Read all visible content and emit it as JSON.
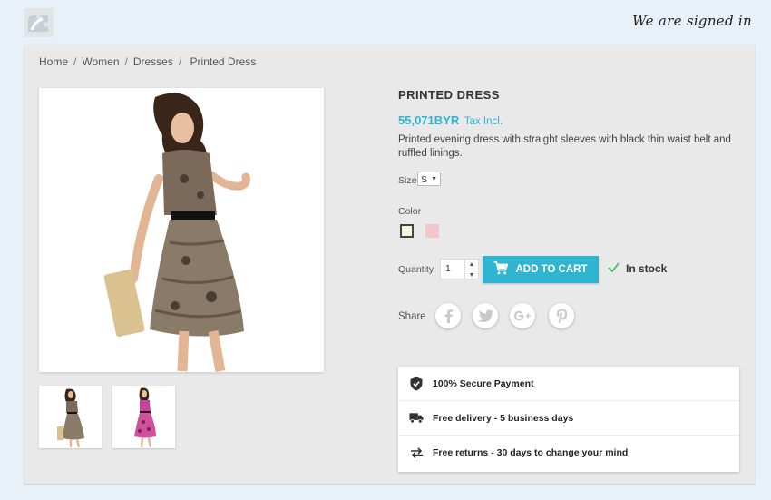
{
  "header": {
    "signed_text": "We are signed in",
    "logo_icon": "puzzle-logo-icon"
  },
  "breadcrumb": {
    "items": [
      "Home",
      "Women",
      "Dresses",
      "Printed Dress"
    ]
  },
  "product": {
    "title": "PRINTED DRESS",
    "price": "55,071BYR",
    "tax_label": "Tax Incl.",
    "description": "Printed evening dress with straight sleeves with black thin waist belt and ruffled linings.",
    "size_label": "Size",
    "size_value": "S",
    "color_label": "Color",
    "colors": [
      "#f5f5dc",
      "#f3c6c9"
    ],
    "quantity_label": "Quantity",
    "quantity_value": "1",
    "add_to_cart_label": "ADD TO CART",
    "stock_label": "In stock",
    "share_label": "Share",
    "share_icons": [
      "facebook-icon",
      "twitter-icon",
      "googleplus-icon",
      "pinterest-icon"
    ]
  },
  "reassurance": {
    "items": [
      {
        "label": "100% Secure Payment",
        "icon": "shield-icon"
      },
      {
        "label": "Free delivery - 5 business days",
        "icon": "truck-icon"
      },
      {
        "label": "Free returns - 30 days to change your mind",
        "icon": "exchange-icon"
      }
    ]
  },
  "colors": {
    "accent": "#2fb5d2",
    "page_bg": "#e8f1f7",
    "card_bg": "#e9e9e9",
    "stock_check": "#4cbb6c"
  }
}
